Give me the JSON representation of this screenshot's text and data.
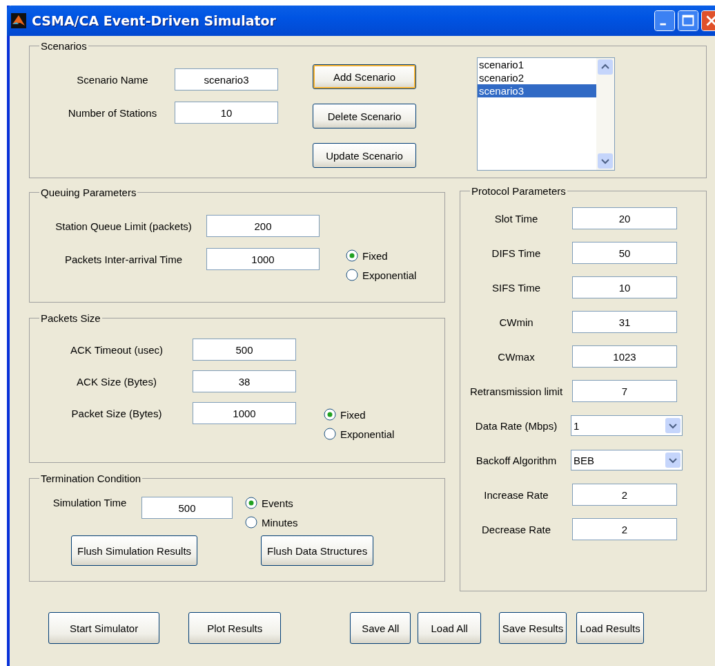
{
  "window": {
    "title": "CSMA/CA Event-Driven Simulator"
  },
  "scenarios": {
    "title": "Scenarios",
    "fields": [
      {
        "label": "Scenario Name",
        "value": "scenario3"
      },
      {
        "label": "Number of Stations",
        "value": "10"
      }
    ],
    "buttons": [
      {
        "label": "Add Scenario",
        "focused": true
      },
      {
        "label": "Delete Scenario",
        "focused": false
      },
      {
        "label": "Update Scenario",
        "focused": false
      }
    ],
    "list": [
      {
        "label": "scenario1",
        "selected": false
      },
      {
        "label": "scenario2",
        "selected": false
      },
      {
        "label": "scenario3",
        "selected": true
      }
    ]
  },
  "queuing": {
    "title": "Queuing Parameters",
    "fields": [
      {
        "label": "Station Queue Limit (packets)",
        "value": "200"
      },
      {
        "label": "Packets Inter-arrival Time",
        "value": "1000"
      }
    ],
    "radios": [
      {
        "label": "Fixed",
        "selected": true
      },
      {
        "label": "Exponential",
        "selected": false
      }
    ]
  },
  "packets_size": {
    "title": "Packets Size",
    "fields": [
      {
        "label": "ACK Timeout (usec)",
        "value": "500"
      },
      {
        "label": "ACK Size (Bytes)",
        "value": "38"
      },
      {
        "label": "Packet Size (Bytes)",
        "value": "1000"
      }
    ],
    "radios": [
      {
        "label": "Fixed",
        "selected": true
      },
      {
        "label": "Exponential",
        "selected": false
      }
    ]
  },
  "termination": {
    "title": "Termination Condition",
    "fields": [
      {
        "label": "Simulation Time",
        "value": "500"
      }
    ],
    "radios": [
      {
        "label": "Events",
        "selected": true
      },
      {
        "label": "Minutes",
        "selected": false
      }
    ],
    "buttons": [
      "Flush Simulation Results",
      "Flush Data Structures"
    ]
  },
  "protocol": {
    "title": "Protocol Parameters",
    "rows": [
      {
        "kind": "text",
        "label": "Slot Time",
        "value": "20"
      },
      {
        "kind": "text",
        "label": "DIFS Time",
        "value": "50"
      },
      {
        "kind": "text",
        "label": "SIFS Time",
        "value": "10"
      },
      {
        "kind": "text",
        "label": "CWmin",
        "value": "31"
      },
      {
        "kind": "text",
        "label": "CWmax",
        "value": "1023"
      },
      {
        "kind": "text",
        "label": "Retransmission limit",
        "value": "7"
      },
      {
        "kind": "dropdown",
        "label": "Data Rate (Mbps)",
        "value": "1"
      },
      {
        "kind": "dropdown",
        "label": "Backoff Algorithm",
        "value": "BEB"
      },
      {
        "kind": "text",
        "label": "Increase Rate",
        "value": "2"
      },
      {
        "kind": "text",
        "label": "Decrease Rate",
        "value": "2"
      }
    ]
  },
  "buttons": [
    "Start Simulator",
    "Plot Results",
    "Save All",
    "Load All",
    "Save Results",
    "Load Results"
  ]
}
